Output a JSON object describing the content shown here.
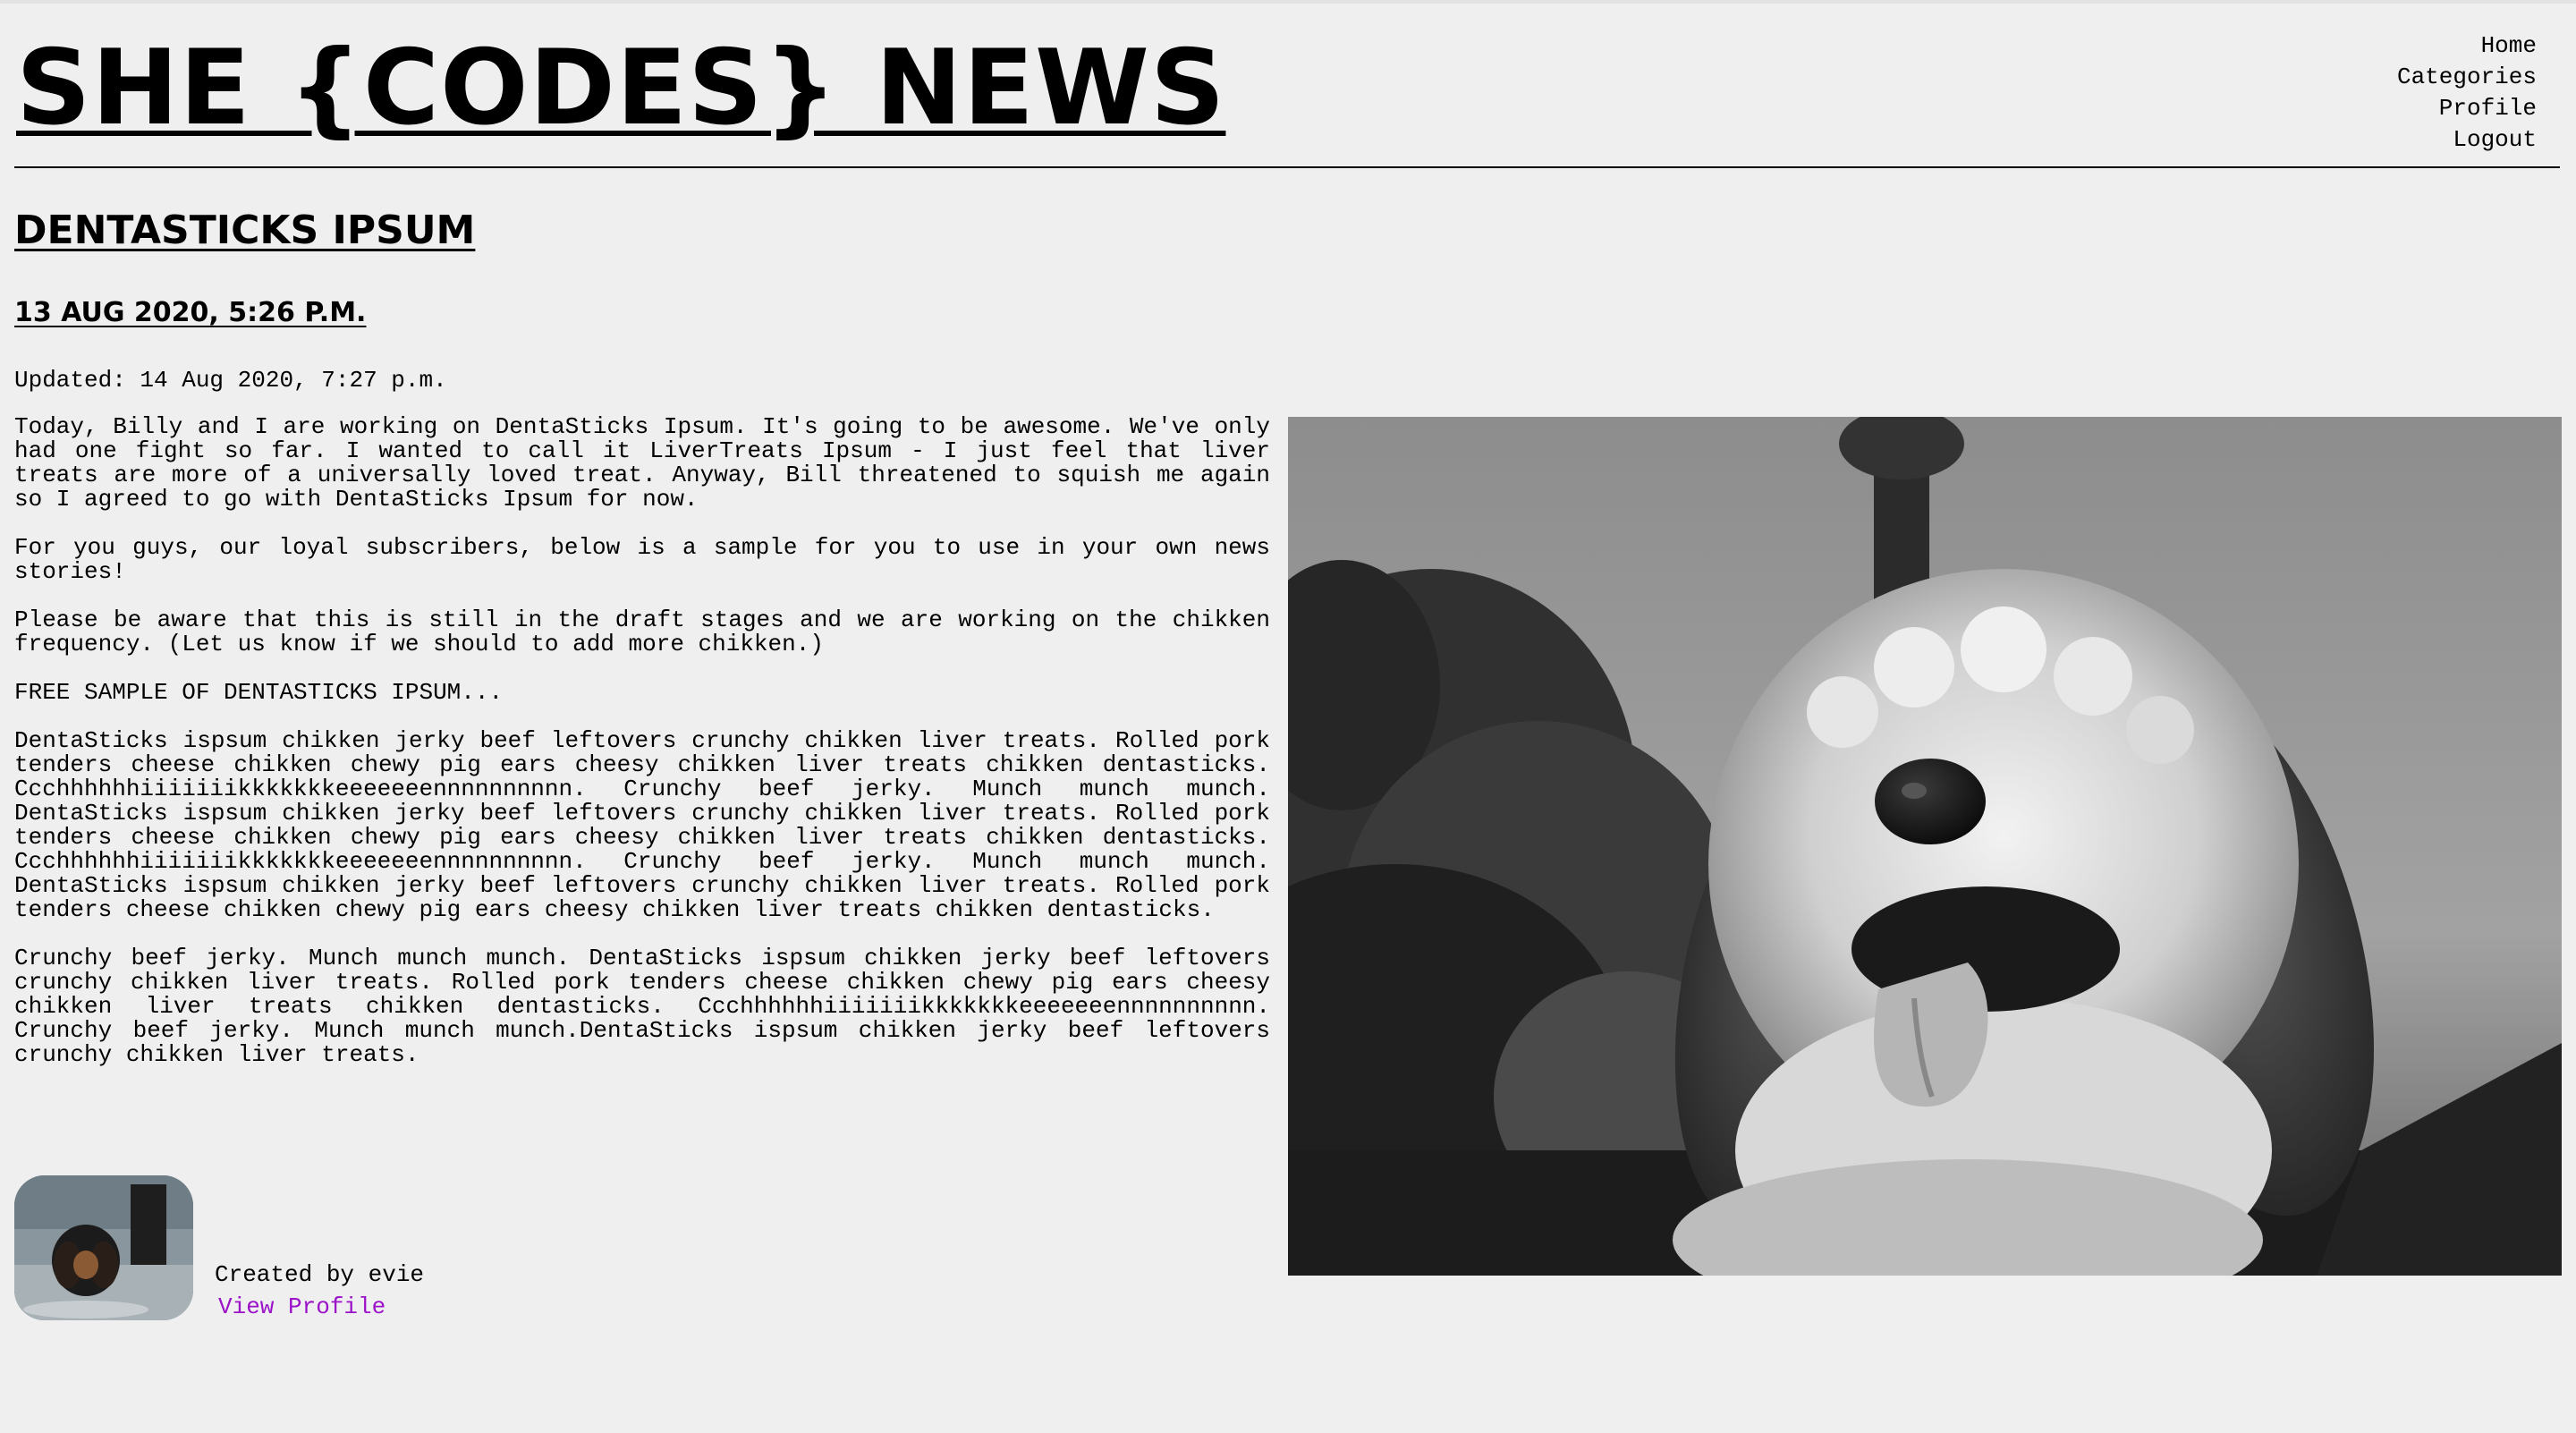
{
  "header": {
    "site_title": "SHE {CODES} NEWS",
    "nav": [
      "Home",
      "Categories",
      "Profile",
      "Logout"
    ]
  },
  "article": {
    "title": "DENTASTICKS IPSUM",
    "date": "13 AUG 2020, 5:26 P.M.",
    "updated": "Updated: 14 Aug 2020, 7:27 p.m.",
    "paragraphs": [
      "Today, Billy and I are working on DentaSticks Ipsum. It's going to be awesome. We've only had one fight so far. I wanted to call it LiverTreats Ipsum - I just feel that liver treats are more of a universally loved treat. Anyway, Bill threatened to squish me again so I agreed to go with DentaSticks Ipsum for now.",
      "For you guys, our loyal subscribers, below is a sample for you to use in your own news stories!",
      "Please be aware that this is still in the draft stages and we are working on the chikken frequency. (Let us know if we should to add more chikken.)",
      "FREE SAMPLE OF DENTASTICKS IPSUM...",
      "DentaSticks ispsum chikken jerky beef leftovers crunchy chikken liver treats. Rolled pork tenders cheese chikken chewy pig ears cheesy chikken liver treats chikken dentasticks. Ccchhhhhhiiiiiiikkkkkkkeeeeeeennnnnnnnnn. Crunchy beef jerky. Munch munch munch. DentaSticks ispsum chikken jerky beef leftovers crunchy chikken liver treats. Rolled pork tenders cheese chikken chewy pig ears cheesy chikken liver treats chikken dentasticks. Ccchhhhhhiiiiiiikkkkkkkeeeeeeennnnnnnnnn. Crunchy beef jerky. Munch munch munch. DentaSticks ispsum chikken jerky beef leftovers crunchy chikken liver treats. Rolled pork tenders cheese chikken chewy pig ears cheesy chikken liver treats chikken dentasticks.",
      "Crunchy beef jerky. Munch munch munch. DentaSticks ispsum chikken jerky beef leftovers crunchy chikken liver treats. Rolled pork tenders cheese chikken chewy pig ears cheesy chikken liver treats chikken dentasticks. Ccchhhhhhiiiiiiikkkkkkkeeeeeeennnnnnnnnn. Crunchy beef jerky. Munch munch munch.DentaSticks ispsum chikken jerky beef leftovers crunchy chikken liver treats."
    ]
  },
  "author": {
    "created_by": "Created by evie",
    "view_profile": "View Profile"
  },
  "colors": {
    "page_background": "#efefef",
    "link_purple": "#9b12c9",
    "text": "#000000"
  }
}
